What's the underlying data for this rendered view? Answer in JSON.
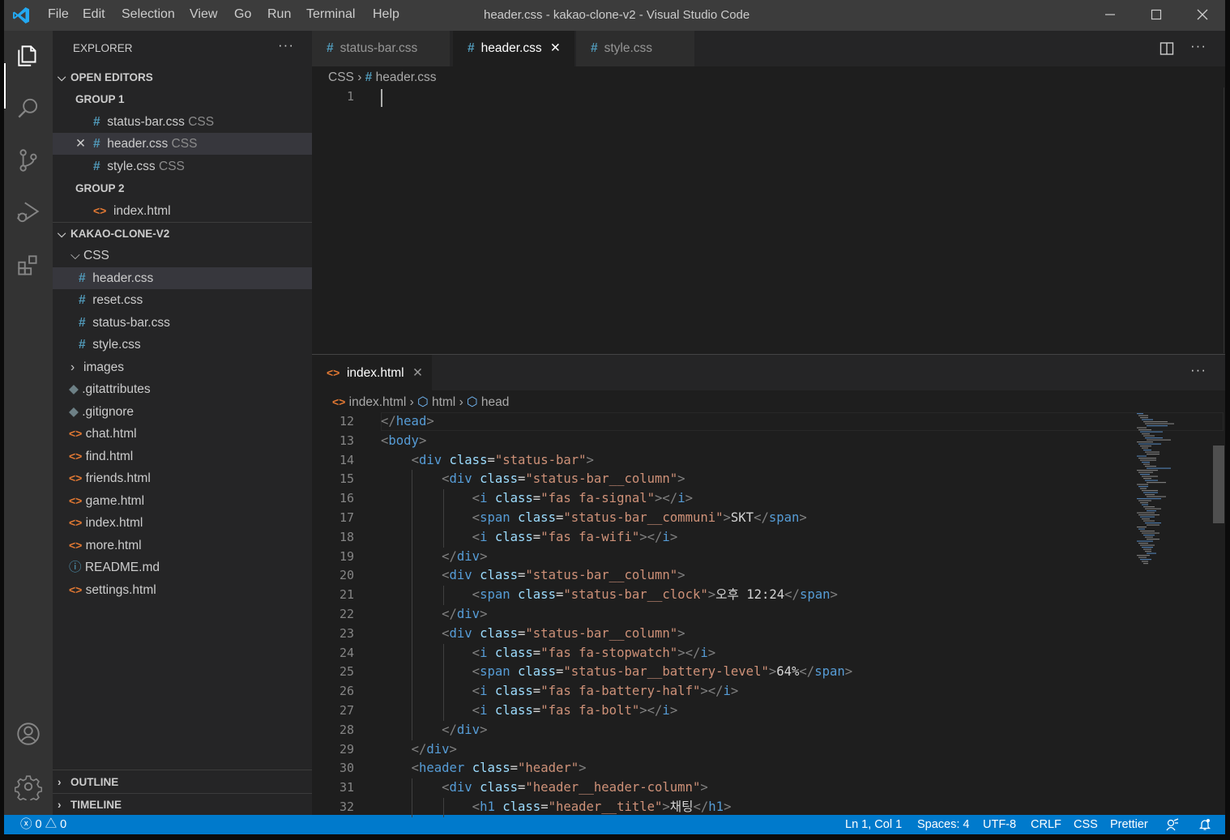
{
  "titlebar": {
    "menu": [
      "File",
      "Edit",
      "Selection",
      "View",
      "Go",
      "Run",
      "Terminal",
      "Help"
    ],
    "title": "header.css - kakao-clone-v2 - Visual Studio Code"
  },
  "activity_bar": {
    "items": [
      "files-icon",
      "search-icon",
      "source-control-icon",
      "run-debug-icon",
      "extensions-icon"
    ],
    "bottom": [
      "account-icon",
      "settings-gear-icon"
    ]
  },
  "sidebar": {
    "title": "EXPLORER",
    "more": "···",
    "open_editors": {
      "label": "OPEN EDITORS",
      "group1": "GROUP 1",
      "group1_items": [
        {
          "name": "status-bar.css",
          "lang": "CSS"
        },
        {
          "name": "header.css",
          "lang": "CSS"
        },
        {
          "name": "style.css",
          "lang": "CSS"
        }
      ],
      "group2": "GROUP 2",
      "group2_items": [
        {
          "name": "index.html"
        }
      ]
    },
    "project": {
      "label": "KAKAO-CLONE-V2",
      "css_folder": "CSS",
      "css_files": [
        "header.css",
        "reset.css",
        "status-bar.css",
        "style.css"
      ],
      "images_folder": "images",
      "files": [
        ".gitattributes",
        ".gitignore",
        "chat.html",
        "find.html",
        "friends.html",
        "game.html",
        "index.html",
        "more.html",
        "README.md",
        "settings.html"
      ]
    },
    "outline": "OUTLINE",
    "timeline": "TIMELINE"
  },
  "editor1": {
    "tabs": [
      "status-bar.css",
      "header.css",
      "style.css"
    ],
    "breadcrumb": [
      "CSS",
      "header.css"
    ],
    "line_numbers": [
      "1"
    ]
  },
  "editor2": {
    "tab": "index.html",
    "more": "···",
    "breadcrumb": [
      "index.html",
      "html",
      "head"
    ],
    "line_numbers": [
      "12",
      "13",
      "14",
      "15",
      "16",
      "17",
      "18",
      "19",
      "20",
      "21",
      "22",
      "23",
      "24",
      "25",
      "26",
      "27",
      "28",
      "29",
      "30",
      "31",
      "32"
    ],
    "lines": [
      {
        "indent": "",
        "parts": [
          [
            "tb",
            "</"
          ],
          [
            "t",
            "head"
          ],
          [
            "tb",
            ">"
          ]
        ]
      },
      {
        "indent": "",
        "parts": [
          [
            "tb",
            "<"
          ],
          [
            "t",
            "body"
          ],
          [
            "tb",
            ">"
          ]
        ]
      },
      {
        "indent": "    ",
        "parts": [
          [
            "tb",
            "<"
          ],
          [
            "t",
            "div"
          ],
          [
            "tx",
            " "
          ],
          [
            "at",
            "class"
          ],
          [
            "tx",
            "="
          ],
          [
            "st",
            "\"status-bar\""
          ],
          [
            "tb",
            ">"
          ]
        ]
      },
      {
        "indent": "        ",
        "parts": [
          [
            "tb",
            "<"
          ],
          [
            "t",
            "div"
          ],
          [
            "tx",
            " "
          ],
          [
            "at",
            "class"
          ],
          [
            "tx",
            "="
          ],
          [
            "st",
            "\"status-bar__column\""
          ],
          [
            "tb",
            ">"
          ]
        ]
      },
      {
        "indent": "            ",
        "parts": [
          [
            "tb",
            "<"
          ],
          [
            "t",
            "i"
          ],
          [
            "tx",
            " "
          ],
          [
            "at",
            "class"
          ],
          [
            "tx",
            "="
          ],
          [
            "st",
            "\"fas fa-signal\""
          ],
          [
            "tb",
            "></"
          ],
          [
            "t",
            "i"
          ],
          [
            "tb",
            ">"
          ]
        ]
      },
      {
        "indent": "            ",
        "parts": [
          [
            "tb",
            "<"
          ],
          [
            "t",
            "span"
          ],
          [
            "tx",
            " "
          ],
          [
            "at",
            "class"
          ],
          [
            "tx",
            "="
          ],
          [
            "st",
            "\"status-bar__communi\""
          ],
          [
            "tb",
            ">"
          ],
          [
            "tx",
            "SKT"
          ],
          [
            "tb",
            "</"
          ],
          [
            "t",
            "span"
          ],
          [
            "tb",
            ">"
          ]
        ]
      },
      {
        "indent": "            ",
        "parts": [
          [
            "tb",
            "<"
          ],
          [
            "t",
            "i"
          ],
          [
            "tx",
            " "
          ],
          [
            "at",
            "class"
          ],
          [
            "tx",
            "="
          ],
          [
            "st",
            "\"fas fa-wifi\""
          ],
          [
            "tb",
            "></"
          ],
          [
            "t",
            "i"
          ],
          [
            "tb",
            ">"
          ]
        ]
      },
      {
        "indent": "        ",
        "parts": [
          [
            "tb",
            "</"
          ],
          [
            "t",
            "div"
          ],
          [
            "tb",
            ">"
          ]
        ]
      },
      {
        "indent": "        ",
        "parts": [
          [
            "tb",
            "<"
          ],
          [
            "t",
            "div"
          ],
          [
            "tx",
            " "
          ],
          [
            "at",
            "class"
          ],
          [
            "tx",
            "="
          ],
          [
            "st",
            "\"status-bar__column\""
          ],
          [
            "tb",
            ">"
          ]
        ]
      },
      {
        "indent": "            ",
        "parts": [
          [
            "tb",
            "<"
          ],
          [
            "t",
            "span"
          ],
          [
            "tx",
            " "
          ],
          [
            "at",
            "class"
          ],
          [
            "tx",
            "="
          ],
          [
            "st",
            "\"status-bar__clock\""
          ],
          [
            "tb",
            ">"
          ],
          [
            "tx",
            "오후 12:24"
          ],
          [
            "tb",
            "</"
          ],
          [
            "t",
            "span"
          ],
          [
            "tb",
            ">"
          ]
        ]
      },
      {
        "indent": "        ",
        "parts": [
          [
            "tb",
            "</"
          ],
          [
            "t",
            "div"
          ],
          [
            "tb",
            ">"
          ]
        ]
      },
      {
        "indent": "        ",
        "parts": [
          [
            "tb",
            "<"
          ],
          [
            "t",
            "div"
          ],
          [
            "tx",
            " "
          ],
          [
            "at",
            "class"
          ],
          [
            "tx",
            "="
          ],
          [
            "st",
            "\"status-bar__column\""
          ],
          [
            "tb",
            ">"
          ]
        ]
      },
      {
        "indent": "            ",
        "parts": [
          [
            "tb",
            "<"
          ],
          [
            "t",
            "i"
          ],
          [
            "tx",
            " "
          ],
          [
            "at",
            "class"
          ],
          [
            "tx",
            "="
          ],
          [
            "st",
            "\"fas fa-stopwatch\""
          ],
          [
            "tb",
            "></"
          ],
          [
            "t",
            "i"
          ],
          [
            "tb",
            ">"
          ]
        ]
      },
      {
        "indent": "            ",
        "parts": [
          [
            "tb",
            "<"
          ],
          [
            "t",
            "span"
          ],
          [
            "tx",
            " "
          ],
          [
            "at",
            "class"
          ],
          [
            "tx",
            "="
          ],
          [
            "st",
            "\"status-bar__battery-level\""
          ],
          [
            "tb",
            ">"
          ],
          [
            "tx",
            "64%"
          ],
          [
            "tb",
            "</"
          ],
          [
            "t",
            "span"
          ],
          [
            "tb",
            ">"
          ]
        ]
      },
      {
        "indent": "            ",
        "parts": [
          [
            "tb",
            "<"
          ],
          [
            "t",
            "i"
          ],
          [
            "tx",
            " "
          ],
          [
            "at",
            "class"
          ],
          [
            "tx",
            "="
          ],
          [
            "st",
            "\"fas fa-battery-half\""
          ],
          [
            "tb",
            "></"
          ],
          [
            "t",
            "i"
          ],
          [
            "tb",
            ">"
          ]
        ]
      },
      {
        "indent": "            ",
        "parts": [
          [
            "tb",
            "<"
          ],
          [
            "t",
            "i"
          ],
          [
            "tx",
            " "
          ],
          [
            "at",
            "class"
          ],
          [
            "tx",
            "="
          ],
          [
            "st",
            "\"fas fa-bolt\""
          ],
          [
            "tb",
            "></"
          ],
          [
            "t",
            "i"
          ],
          [
            "tb",
            ">"
          ]
        ]
      },
      {
        "indent": "        ",
        "parts": [
          [
            "tb",
            "</"
          ],
          [
            "t",
            "div"
          ],
          [
            "tb",
            ">"
          ]
        ]
      },
      {
        "indent": "    ",
        "parts": [
          [
            "tb",
            "</"
          ],
          [
            "t",
            "div"
          ],
          [
            "tb",
            ">"
          ]
        ]
      },
      {
        "indent": "    ",
        "parts": [
          [
            "tb",
            "<"
          ],
          [
            "t",
            "header"
          ],
          [
            "tx",
            " "
          ],
          [
            "at",
            "class"
          ],
          [
            "tx",
            "="
          ],
          [
            "st",
            "\"header\""
          ],
          [
            "tb",
            ">"
          ]
        ]
      },
      {
        "indent": "        ",
        "parts": [
          [
            "tb",
            "<"
          ],
          [
            "t",
            "div"
          ],
          [
            "tx",
            " "
          ],
          [
            "at",
            "class"
          ],
          [
            "tx",
            "="
          ],
          [
            "st",
            "\"header__header-column\""
          ],
          [
            "tb",
            ">"
          ]
        ]
      },
      {
        "indent": "            ",
        "parts": [
          [
            "tb",
            "<"
          ],
          [
            "t",
            "h1"
          ],
          [
            "tx",
            " "
          ],
          [
            "at",
            "class"
          ],
          [
            "tx",
            "="
          ],
          [
            "st",
            "\"header__title\""
          ],
          [
            "tb",
            ">"
          ],
          [
            "tx",
            "채팅"
          ],
          [
            "tb",
            "</"
          ],
          [
            "t",
            "h1"
          ],
          [
            "tb",
            ">"
          ]
        ]
      }
    ]
  },
  "statusbar": {
    "errors": "0",
    "warnings": "0",
    "position": "Ln 1, Col 1",
    "spaces": "Spaces: 4",
    "encoding": "UTF-8",
    "eol": "CRLF",
    "language": "CSS",
    "formatter": "Prettier"
  }
}
